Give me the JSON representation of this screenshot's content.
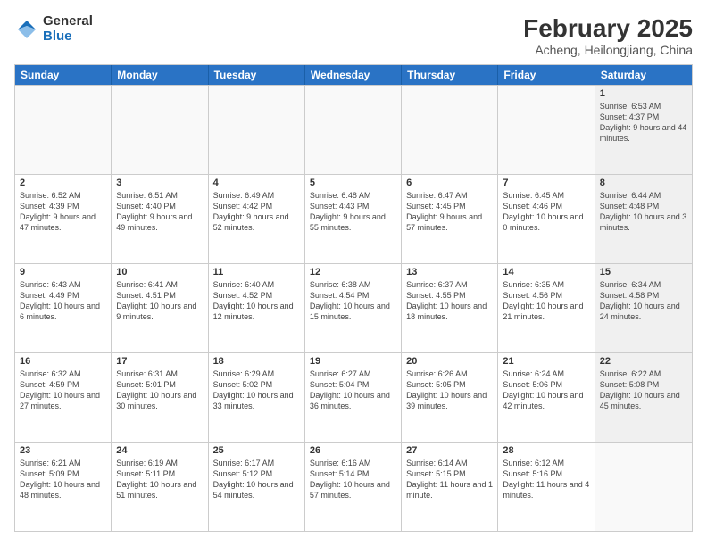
{
  "logo": {
    "general": "General",
    "blue": "Blue"
  },
  "title": "February 2025",
  "location": "Acheng, Heilongjiang, China",
  "header_days": [
    "Sunday",
    "Monday",
    "Tuesday",
    "Wednesday",
    "Thursday",
    "Friday",
    "Saturday"
  ],
  "weeks": [
    [
      {
        "day": "",
        "info": "",
        "shaded": false,
        "empty": true
      },
      {
        "day": "",
        "info": "",
        "shaded": false,
        "empty": true
      },
      {
        "day": "",
        "info": "",
        "shaded": false,
        "empty": true
      },
      {
        "day": "",
        "info": "",
        "shaded": false,
        "empty": true
      },
      {
        "day": "",
        "info": "",
        "shaded": false,
        "empty": true
      },
      {
        "day": "",
        "info": "",
        "shaded": false,
        "empty": true
      },
      {
        "day": "1",
        "info": "Sunrise: 6:53 AM\nSunset: 4:37 PM\nDaylight: 9 hours and 44 minutes.",
        "shaded": true,
        "empty": false
      }
    ],
    [
      {
        "day": "2",
        "info": "Sunrise: 6:52 AM\nSunset: 4:39 PM\nDaylight: 9 hours and 47 minutes.",
        "shaded": false,
        "empty": false
      },
      {
        "day": "3",
        "info": "Sunrise: 6:51 AM\nSunset: 4:40 PM\nDaylight: 9 hours and 49 minutes.",
        "shaded": false,
        "empty": false
      },
      {
        "day": "4",
        "info": "Sunrise: 6:49 AM\nSunset: 4:42 PM\nDaylight: 9 hours and 52 minutes.",
        "shaded": false,
        "empty": false
      },
      {
        "day": "5",
        "info": "Sunrise: 6:48 AM\nSunset: 4:43 PM\nDaylight: 9 hours and 55 minutes.",
        "shaded": false,
        "empty": false
      },
      {
        "day": "6",
        "info": "Sunrise: 6:47 AM\nSunset: 4:45 PM\nDaylight: 9 hours and 57 minutes.",
        "shaded": false,
        "empty": false
      },
      {
        "day": "7",
        "info": "Sunrise: 6:45 AM\nSunset: 4:46 PM\nDaylight: 10 hours and 0 minutes.",
        "shaded": false,
        "empty": false
      },
      {
        "day": "8",
        "info": "Sunrise: 6:44 AM\nSunset: 4:48 PM\nDaylight: 10 hours and 3 minutes.",
        "shaded": true,
        "empty": false
      }
    ],
    [
      {
        "day": "9",
        "info": "Sunrise: 6:43 AM\nSunset: 4:49 PM\nDaylight: 10 hours and 6 minutes.",
        "shaded": false,
        "empty": false
      },
      {
        "day": "10",
        "info": "Sunrise: 6:41 AM\nSunset: 4:51 PM\nDaylight: 10 hours and 9 minutes.",
        "shaded": false,
        "empty": false
      },
      {
        "day": "11",
        "info": "Sunrise: 6:40 AM\nSunset: 4:52 PM\nDaylight: 10 hours and 12 minutes.",
        "shaded": false,
        "empty": false
      },
      {
        "day": "12",
        "info": "Sunrise: 6:38 AM\nSunset: 4:54 PM\nDaylight: 10 hours and 15 minutes.",
        "shaded": false,
        "empty": false
      },
      {
        "day": "13",
        "info": "Sunrise: 6:37 AM\nSunset: 4:55 PM\nDaylight: 10 hours and 18 minutes.",
        "shaded": false,
        "empty": false
      },
      {
        "day": "14",
        "info": "Sunrise: 6:35 AM\nSunset: 4:56 PM\nDaylight: 10 hours and 21 minutes.",
        "shaded": false,
        "empty": false
      },
      {
        "day": "15",
        "info": "Sunrise: 6:34 AM\nSunset: 4:58 PM\nDaylight: 10 hours and 24 minutes.",
        "shaded": true,
        "empty": false
      }
    ],
    [
      {
        "day": "16",
        "info": "Sunrise: 6:32 AM\nSunset: 4:59 PM\nDaylight: 10 hours and 27 minutes.",
        "shaded": false,
        "empty": false
      },
      {
        "day": "17",
        "info": "Sunrise: 6:31 AM\nSunset: 5:01 PM\nDaylight: 10 hours and 30 minutes.",
        "shaded": false,
        "empty": false
      },
      {
        "day": "18",
        "info": "Sunrise: 6:29 AM\nSunset: 5:02 PM\nDaylight: 10 hours and 33 minutes.",
        "shaded": false,
        "empty": false
      },
      {
        "day": "19",
        "info": "Sunrise: 6:27 AM\nSunset: 5:04 PM\nDaylight: 10 hours and 36 minutes.",
        "shaded": false,
        "empty": false
      },
      {
        "day": "20",
        "info": "Sunrise: 6:26 AM\nSunset: 5:05 PM\nDaylight: 10 hours and 39 minutes.",
        "shaded": false,
        "empty": false
      },
      {
        "day": "21",
        "info": "Sunrise: 6:24 AM\nSunset: 5:06 PM\nDaylight: 10 hours and 42 minutes.",
        "shaded": false,
        "empty": false
      },
      {
        "day": "22",
        "info": "Sunrise: 6:22 AM\nSunset: 5:08 PM\nDaylight: 10 hours and 45 minutes.",
        "shaded": true,
        "empty": false
      }
    ],
    [
      {
        "day": "23",
        "info": "Sunrise: 6:21 AM\nSunset: 5:09 PM\nDaylight: 10 hours and 48 minutes.",
        "shaded": false,
        "empty": false
      },
      {
        "day": "24",
        "info": "Sunrise: 6:19 AM\nSunset: 5:11 PM\nDaylight: 10 hours and 51 minutes.",
        "shaded": false,
        "empty": false
      },
      {
        "day": "25",
        "info": "Sunrise: 6:17 AM\nSunset: 5:12 PM\nDaylight: 10 hours and 54 minutes.",
        "shaded": false,
        "empty": false
      },
      {
        "day": "26",
        "info": "Sunrise: 6:16 AM\nSunset: 5:14 PM\nDaylight: 10 hours and 57 minutes.",
        "shaded": false,
        "empty": false
      },
      {
        "day": "27",
        "info": "Sunrise: 6:14 AM\nSunset: 5:15 PM\nDaylight: 11 hours and 1 minute.",
        "shaded": false,
        "empty": false
      },
      {
        "day": "28",
        "info": "Sunrise: 6:12 AM\nSunset: 5:16 PM\nDaylight: 11 hours and 4 minutes.",
        "shaded": false,
        "empty": false
      },
      {
        "day": "",
        "info": "",
        "shaded": true,
        "empty": true
      }
    ]
  ]
}
